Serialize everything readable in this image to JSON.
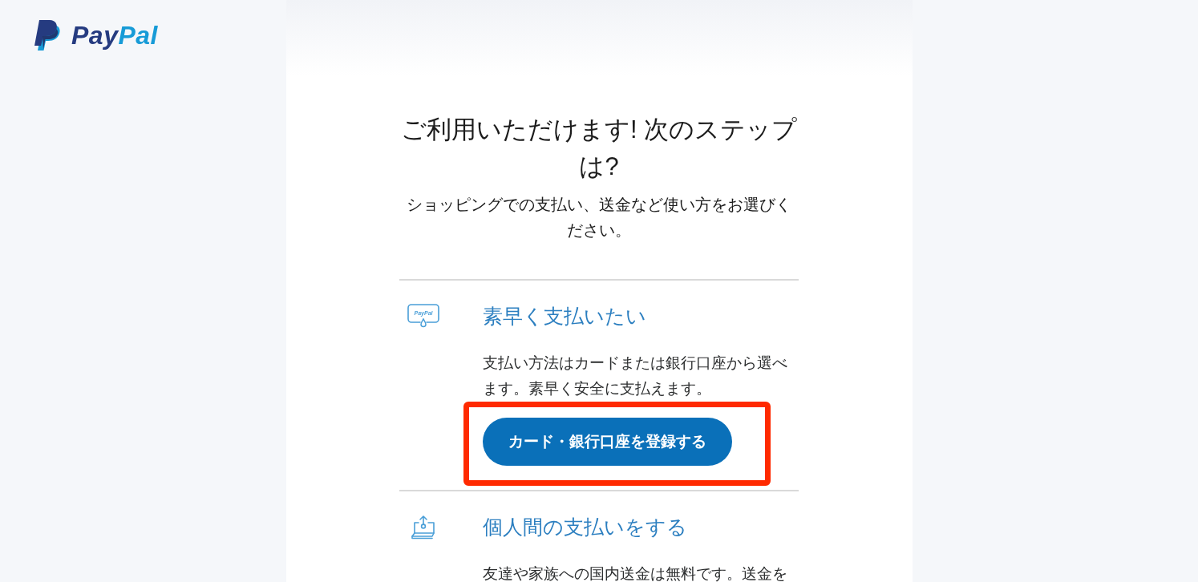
{
  "logo": {
    "parts": [
      {
        "text": "Pay",
        "color": "#253b80"
      },
      {
        "text": "Pal",
        "color": "#179bd7"
      }
    ]
  },
  "heading": "ご利用いただけます! 次のステップは?",
  "subtitle": "ショッピングでの支払い、送金など使い方をお選びください。",
  "options": [
    {
      "kind": "pay",
      "icon_text": "PayPal",
      "title": "素早く支払いたい",
      "description": "支払い方法はカードまたは銀行口座から選べます。素早く安全に支払えます。",
      "button": {
        "label": "カード・銀行口座を登録する",
        "highlighted": true
      }
    },
    {
      "kind": "send",
      "title": "個人間の支払いをする",
      "description": "友達や家族への国内送金は無料です。送金を"
    }
  ]
}
